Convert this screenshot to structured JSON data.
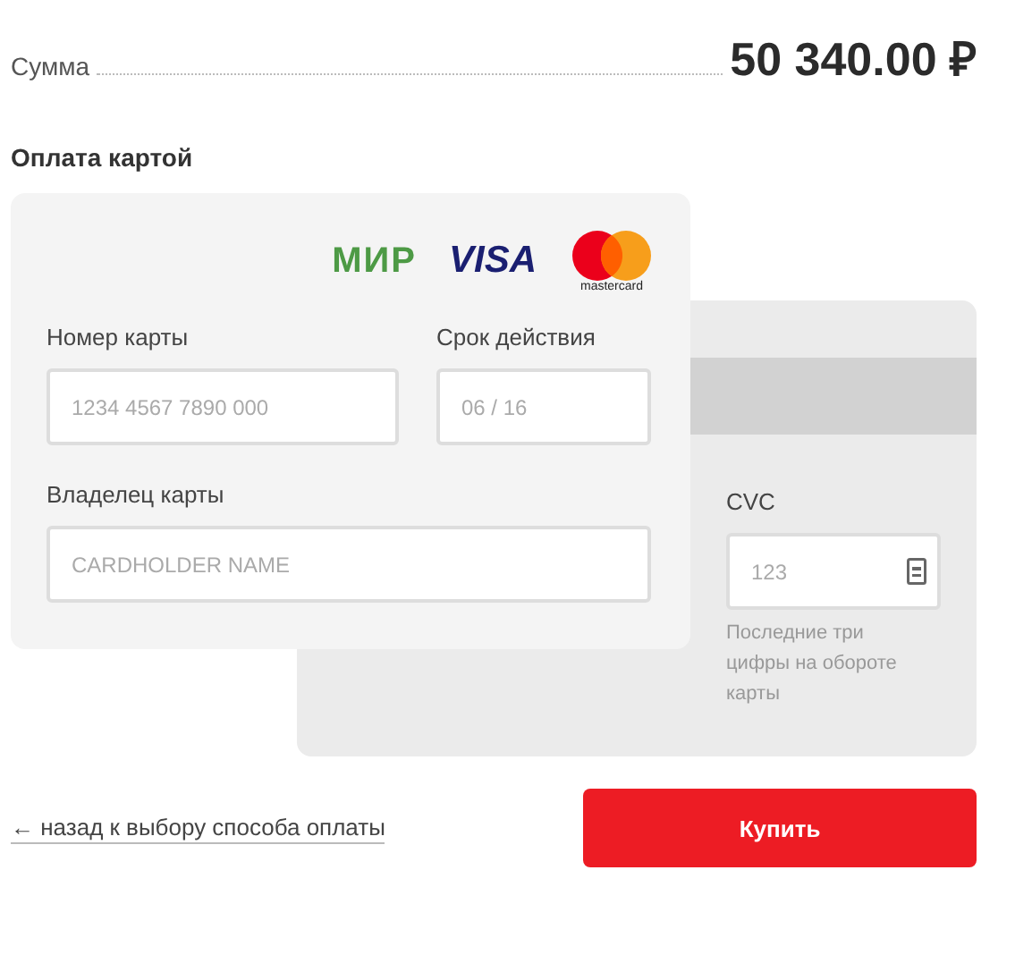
{
  "summary": {
    "label": "Сумма",
    "amount": "50 340.00 ₽"
  },
  "section_title": "Оплата картой",
  "logos": {
    "mir": "МИР",
    "visa": "VISA",
    "mastercard": "mastercard"
  },
  "front_fields": [
    {
      "label": "Номер карты",
      "placeholder": "1234 4567 7890 000"
    },
    {
      "label": "Срок действия",
      "placeholder": "06 / 16"
    },
    {
      "label": "Владелец карты",
      "placeholder": "CARDHOLDER NAME"
    }
  ],
  "cvc": {
    "label": "CVC",
    "placeholder": "123",
    "hint": "Последние три цифры на обороте карты"
  },
  "back_link": "← назад к выбору способа оплаты",
  "buy_button": "Купить"
}
